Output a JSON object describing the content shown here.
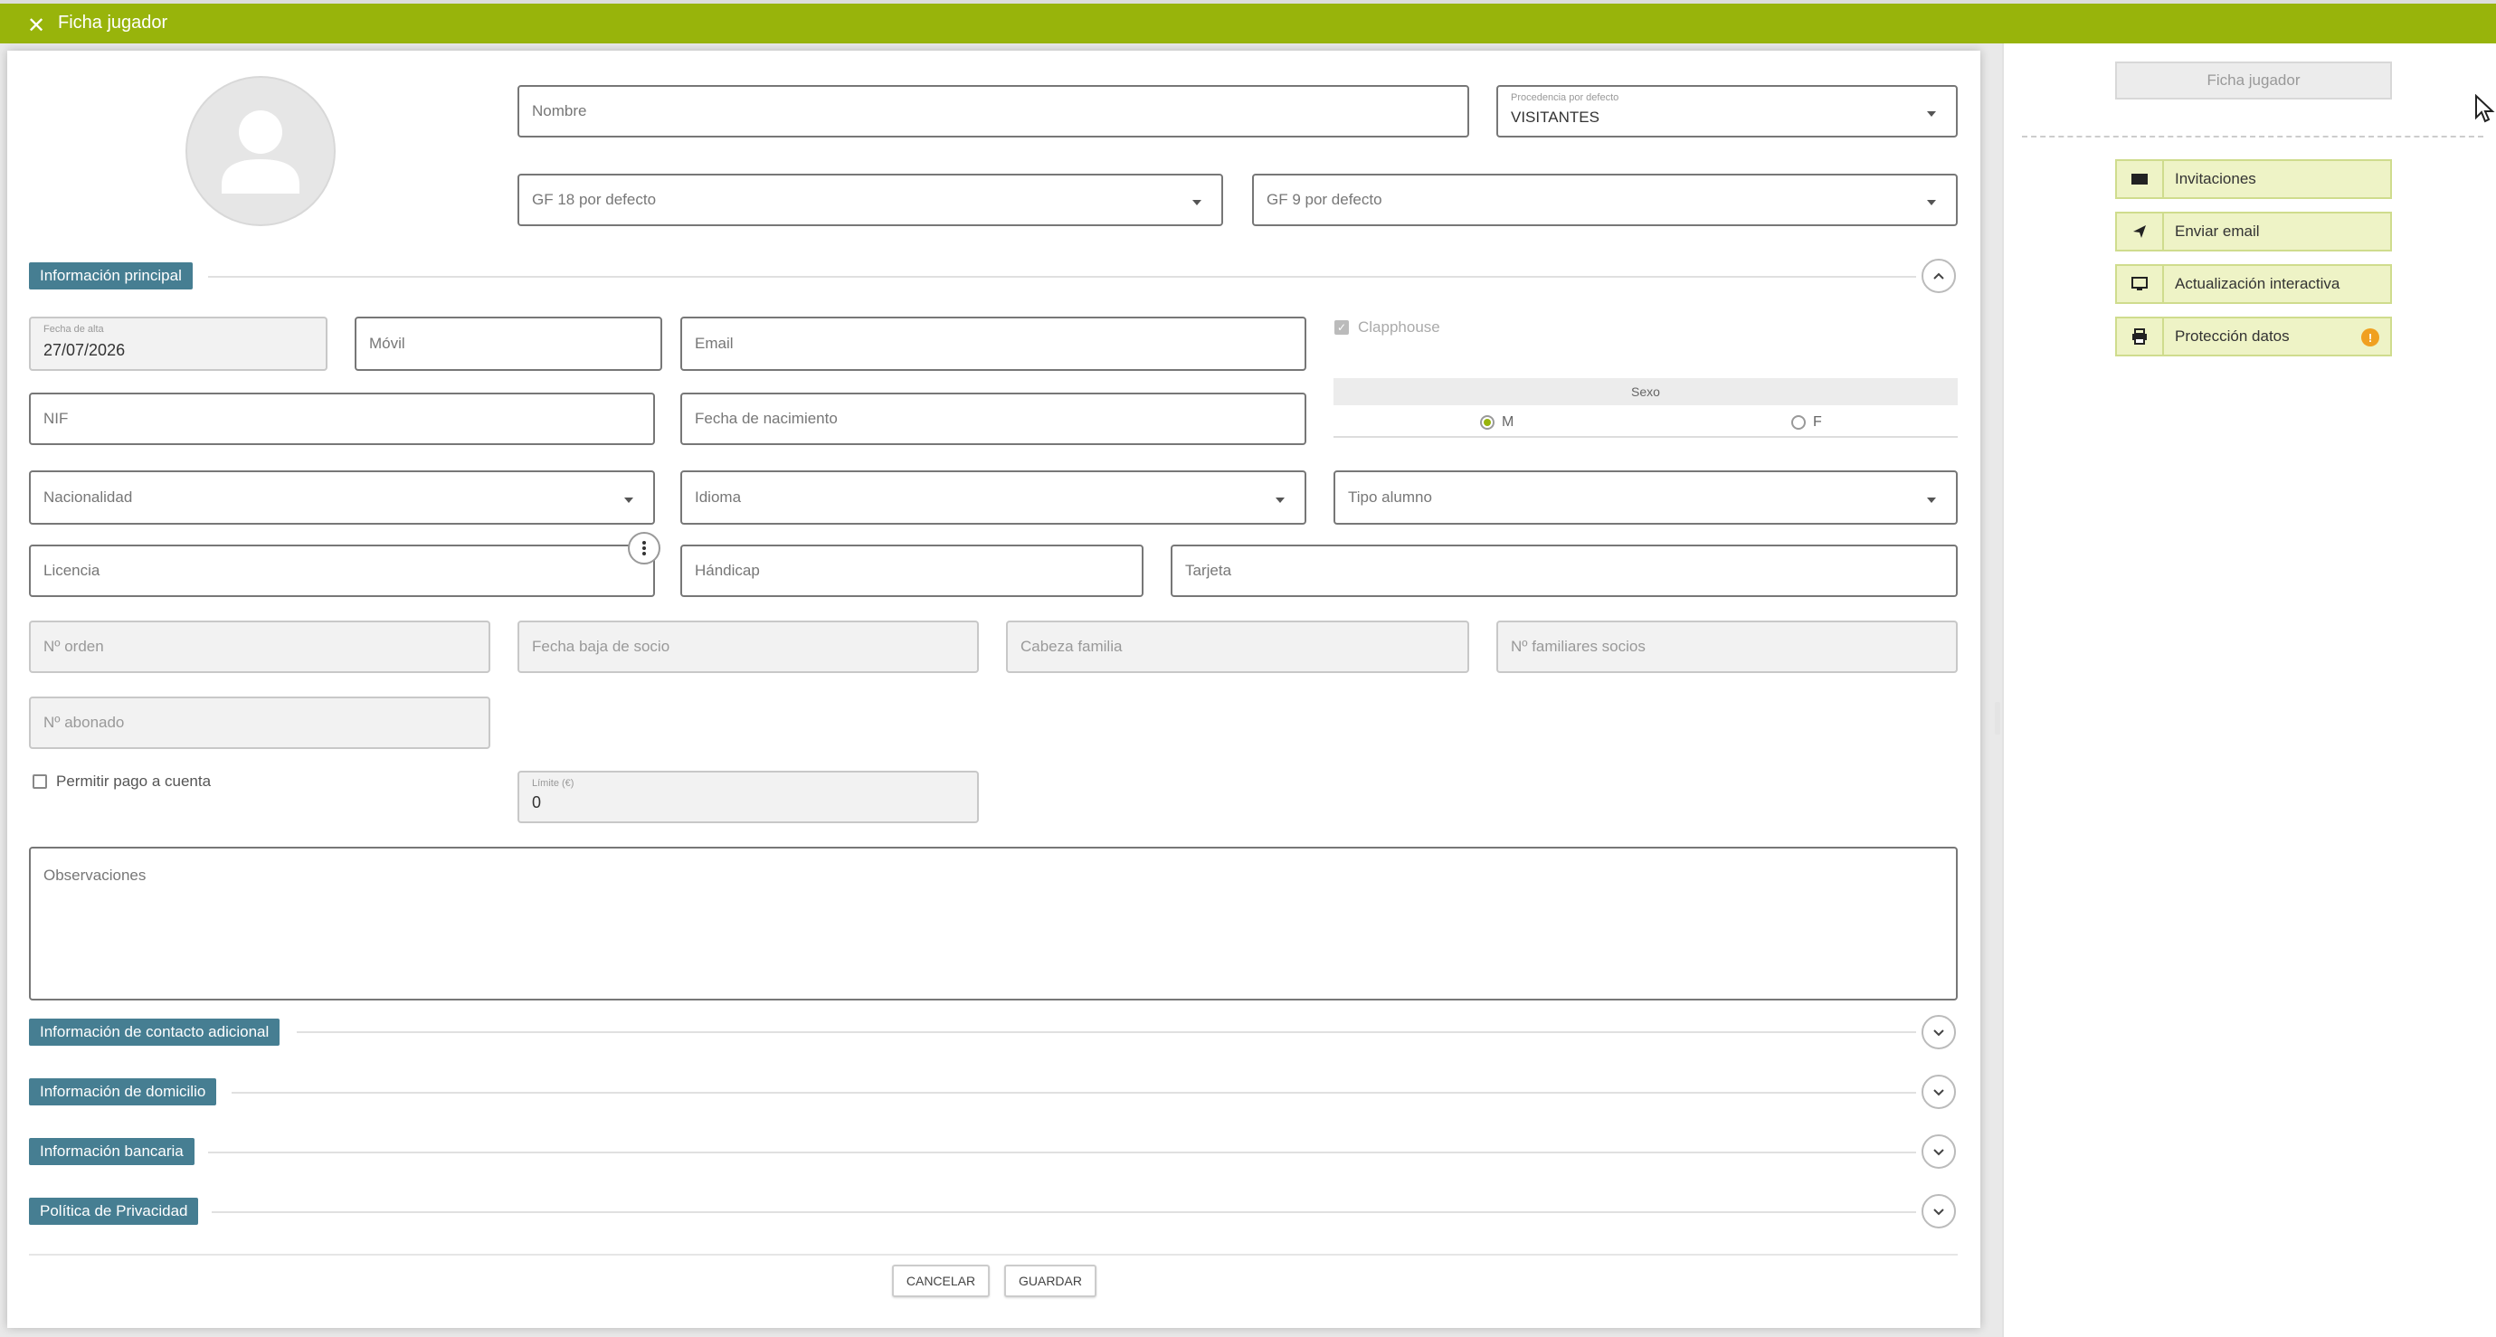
{
  "window": {
    "title": "Ficha jugador",
    "close_icon": "✕"
  },
  "header": {
    "nombre_placeholder": "Nombre",
    "procedencia_label": "Procedencia por defecto",
    "procedencia_value": "VISITANTES",
    "gf18_placeholder": "GF 18 por defecto",
    "gf9_placeholder": "GF 9 por defecto"
  },
  "sections": {
    "principal": "Información principal",
    "contacto": "Información de contacto adicional",
    "domicilio": "Información de domicilio",
    "bancaria": "Información bancaria",
    "privacidad": "Política de Privacidad"
  },
  "form": {
    "fecha_alta_label": "Fecha de alta",
    "fecha_alta_value": "27/07/2026",
    "movil": "Móvil",
    "email": "Email",
    "clapphouse": "Clapphouse",
    "nif": "NIF",
    "fecha_nacimiento": "Fecha de nacimiento",
    "sexo_label": "Sexo",
    "sexo_m": "M",
    "sexo_f": "F",
    "nacionalidad": "Nacionalidad",
    "idioma": "Idioma",
    "tipo_alumno": "Tipo alumno",
    "licencia": "Licencia",
    "handicap": "Hándicap",
    "tarjeta": "Tarjeta",
    "n_orden": "Nº orden",
    "fecha_baja": "Fecha baja de socio",
    "cabeza_familia": "Cabeza familia",
    "n_familiares": "Nº familiares socios",
    "n_abonado": "Nº abonado",
    "permitir_pago": "Permitir pago a cuenta",
    "limite_label": "Límite (€)",
    "limite_value": "0",
    "observaciones": "Observaciones"
  },
  "footer": {
    "cancelar": "CANCELAR",
    "guardar": "GUARDAR"
  },
  "sidebar": {
    "ficha_jugador": "Ficha jugador",
    "items": [
      {
        "label": "Invitaciones",
        "icon": "ticket-icon"
      },
      {
        "label": "Enviar email",
        "icon": "send-icon"
      },
      {
        "label": "Actualización interactiva",
        "icon": "monitor-icon"
      },
      {
        "label": "Protección datos",
        "icon": "printer-icon",
        "badge": "!"
      }
    ]
  },
  "colors": {
    "topbar": "#98b40b",
    "section_header": "#467e92",
    "sidebar_button": "#eef3c6",
    "badge": "#f0a020"
  }
}
